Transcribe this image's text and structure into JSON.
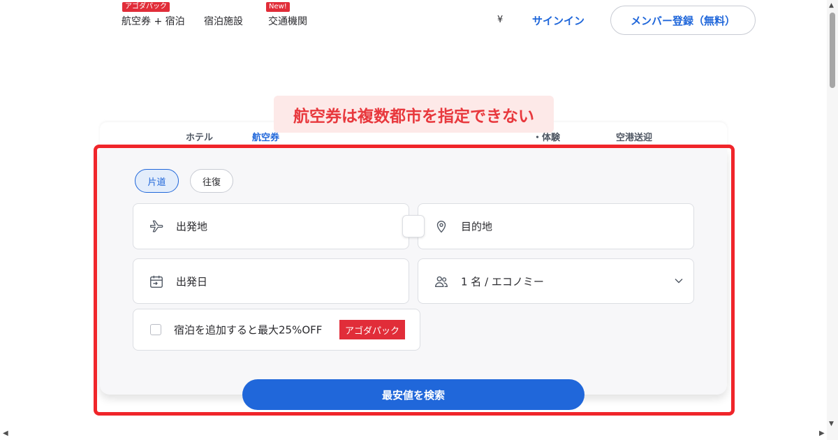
{
  "nav": {
    "items": [
      {
        "label": "航空券 + 宿泊",
        "badge": "アゴダパック"
      },
      {
        "label": "宿泊施設"
      },
      {
        "label": "交通機関",
        "badge": "New!"
      }
    ],
    "currency": "¥",
    "signin": "サインイン",
    "register": "メンバー登録（無料）"
  },
  "annotation": "航空券は複数都市を指定できない",
  "tabs": [
    {
      "label": "ホテル"
    },
    {
      "label": "航空券",
      "active": true
    },
    {
      "label": "・体験"
    },
    {
      "label": "空港送迎"
    }
  ],
  "trip_type": {
    "one_way": "片道",
    "round_trip": "往復",
    "selected": "片道"
  },
  "fields": {
    "origin": {
      "placeholder": "出発地",
      "icon": "airplane-icon"
    },
    "destination": {
      "placeholder": "目的地",
      "icon": "map-pin-icon"
    },
    "depart_date": {
      "placeholder": "出発日",
      "icon": "calendar-icon"
    },
    "travelers": {
      "value": "1 名 / エコノミー",
      "icon": "people-icon"
    }
  },
  "add_hotel": {
    "label": "宿泊を追加すると最大25%OFF",
    "badge": "アゴダパック",
    "checked": false
  },
  "search_button": "最安値を検索",
  "colors": {
    "accent": "#2067da",
    "badge_red": "#e12d39",
    "annotation_red": "#f0252a",
    "annotation_bg": "#fde9e8"
  }
}
